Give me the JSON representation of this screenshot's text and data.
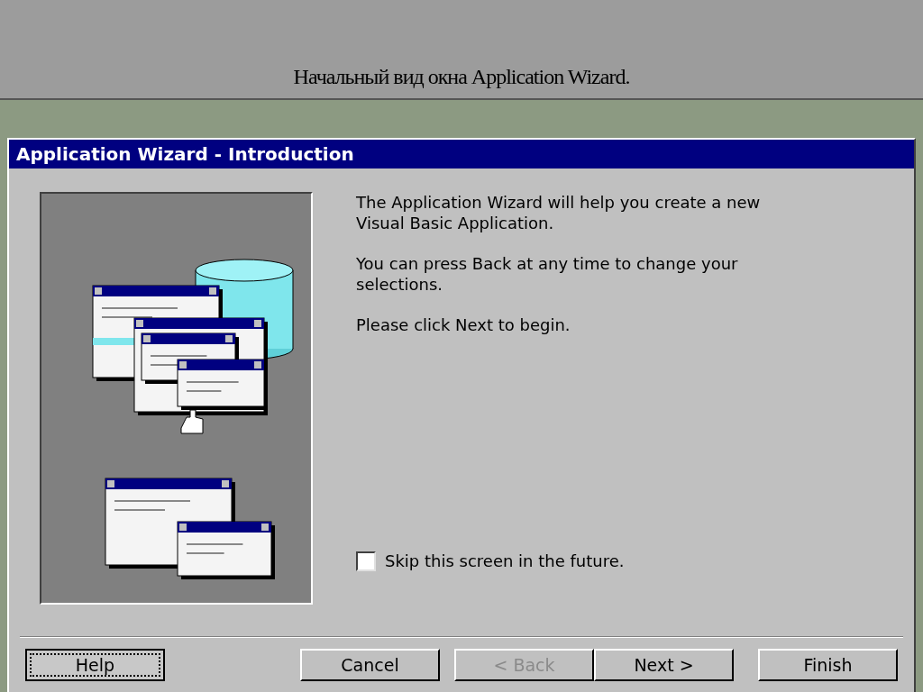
{
  "slide": {
    "title": "Начальный вид окна Application Wizard."
  },
  "window": {
    "title": "Application Wizard - Introduction"
  },
  "paragraphs": [
    "The Application Wizard will help you create a new Visual Basic Application.",
    "You can press Back at any time to change your selections.",
    "Please click Next to begin."
  ],
  "skip_checkbox": {
    "label": "Skip this screen in the future.",
    "checked": false
  },
  "buttons": [
    {
      "label": "Help",
      "disabled": false,
      "focused": true
    },
    {
      "label": "Cancel",
      "disabled": false,
      "focused": false
    },
    {
      "label": "< Back",
      "disabled": true,
      "focused": false
    },
    {
      "label": "Next >",
      "disabled": false,
      "focused": false
    },
    {
      "label": "Finish",
      "disabled": false,
      "focused": false
    }
  ]
}
